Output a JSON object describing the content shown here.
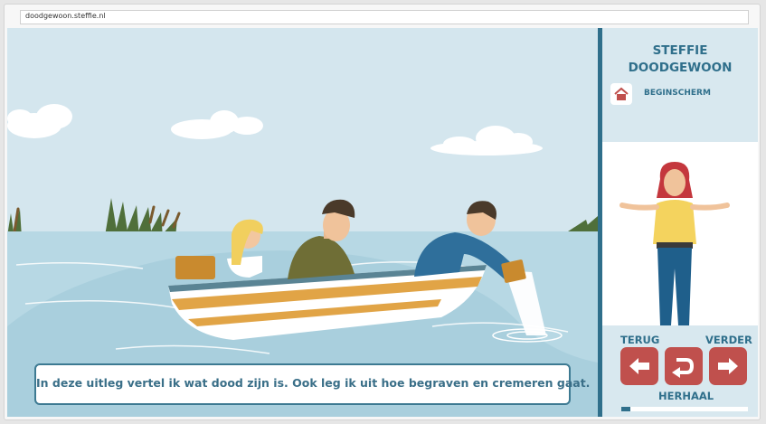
{
  "browser": {
    "url": "doodgewoon.steffie.nl"
  },
  "scene": {
    "caption": "In deze uitleg vertel ik wat dood zijn is. Ook leg ik uit hoe begraven en cremeren gaat."
  },
  "sidebar": {
    "title_line1": "STEFFIE",
    "title_line2": "DOODGEWOON",
    "home_label": "BEGINSCHERM",
    "home_icon": "house-icon",
    "nav": {
      "back_label": "TERUG",
      "next_label": "VERDER",
      "repeat_label": "HERHAAL",
      "back_icon": "arrow-left-icon",
      "repeat_icon": "replay-icon",
      "next_icon": "arrow-right-icon"
    },
    "progress": 0.07
  },
  "colors": {
    "accent": "#2f6f8b",
    "button": "#c0504d",
    "sky": "#d4e6ee",
    "water": "#b7d8e4"
  }
}
